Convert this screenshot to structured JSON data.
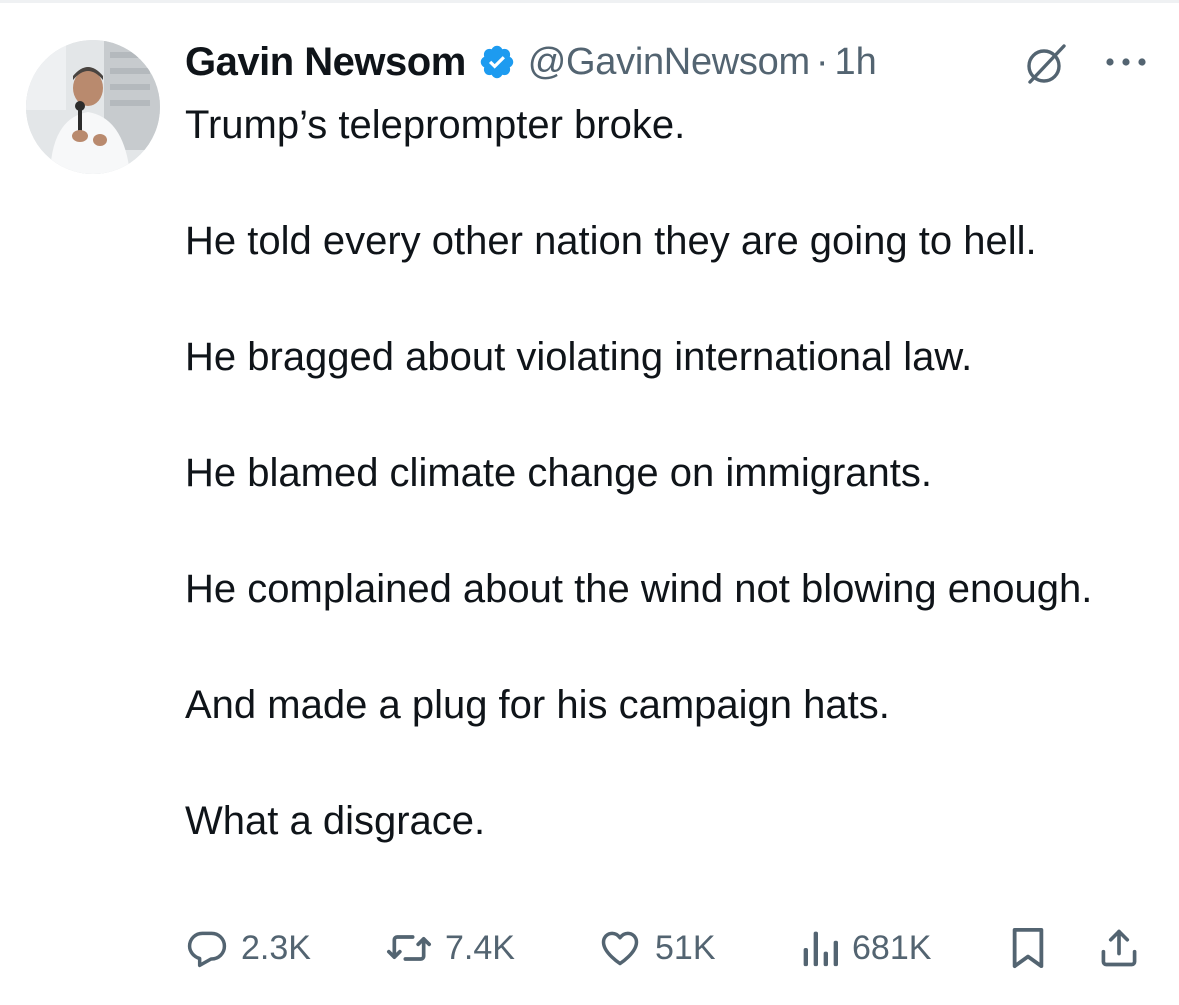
{
  "tweet": {
    "author": {
      "display_name": "Gavin Newsom",
      "handle": "@GavinNewsom",
      "verified": true,
      "avatar_icon": "profile-photo"
    },
    "time_separator": "·",
    "time": "1h",
    "paragraphs": [
      "Trump’s teleprompter broke.",
      "He told every other nation they are going to hell.",
      "He bragged about violating international law.",
      "He blamed climate change on immigrants.",
      "He complained about the wind not blowing enough.",
      "And made a plug for his campaign hats.",
      "What a disgrace."
    ],
    "metrics": {
      "replies": "2.3K",
      "reposts": "7.4K",
      "likes": "51K",
      "views": "681K"
    },
    "icons": {
      "verified": "verified-badge-icon",
      "grok": "grok-icon",
      "more": "more-icon",
      "reply": "reply-icon",
      "repost": "repost-icon",
      "like": "like-icon",
      "views": "views-icon",
      "bookmark": "bookmark-icon",
      "share": "share-icon"
    },
    "colors": {
      "text": "#0f1419",
      "secondary": "#536471",
      "verified": "#1d9bf0"
    }
  }
}
